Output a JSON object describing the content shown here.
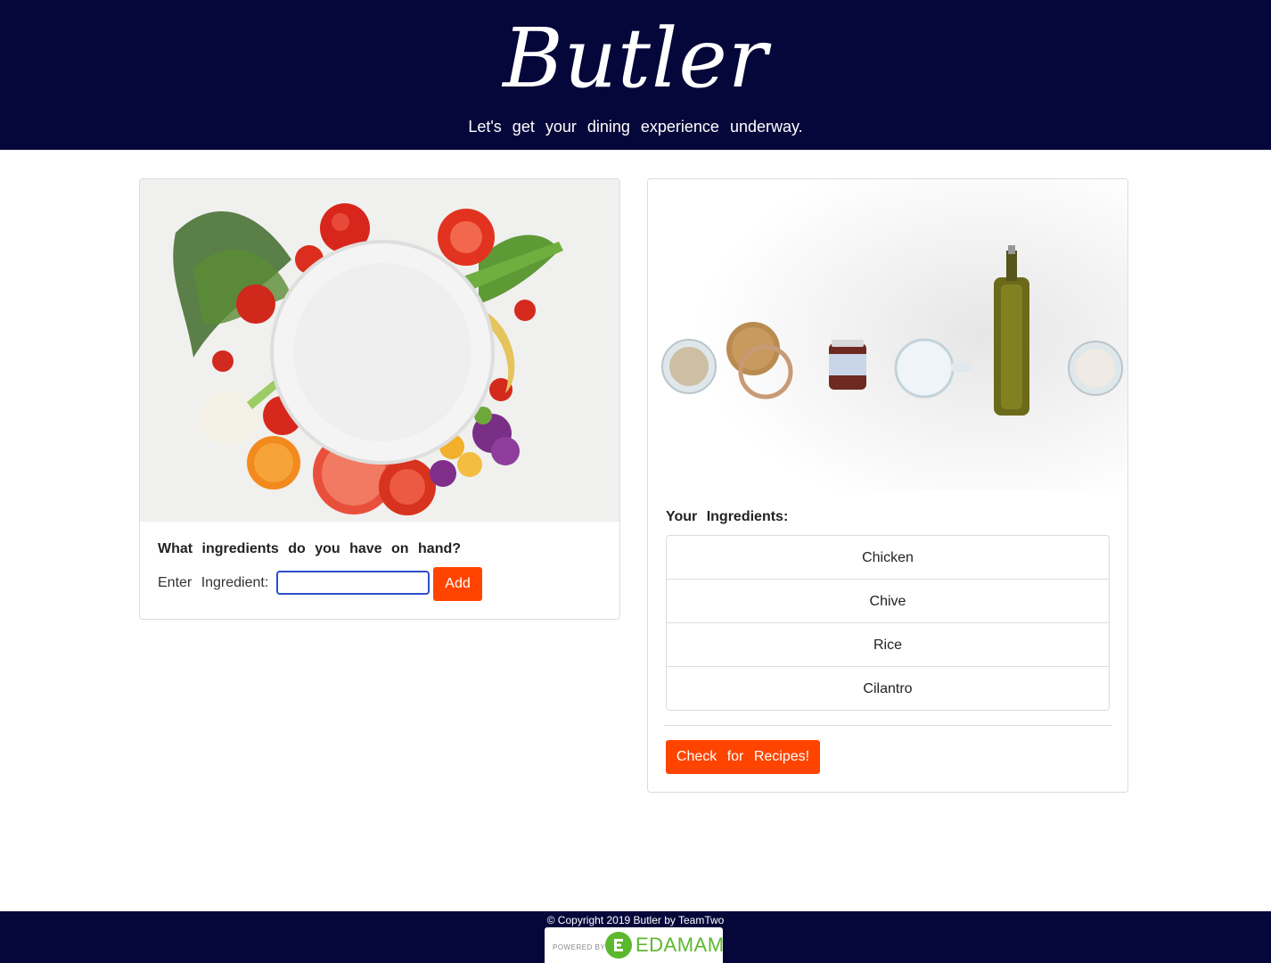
{
  "header": {
    "brand": "Butler",
    "tagline": "Let's get your dining experience underway."
  },
  "add_card": {
    "image_icon": "vegetables-plate-photo",
    "question": "What ingredients do you have on hand?",
    "enter_label": "Enter Ingredient:",
    "input_value": "",
    "add_label": "Add"
  },
  "ingredients_card": {
    "image_icon": "pantry-ingredients-photo",
    "title": "Your Ingredients:",
    "items": [
      "Chicken",
      "Chive",
      "Rice",
      "Cilantro"
    ],
    "check_label": "Check for Recipes!"
  },
  "footer": {
    "copyright": "© Copyright 2019 Butler by TeamTwo",
    "powered_by": "POWERED BY",
    "edamam": "EDAMAM"
  },
  "colors": {
    "navy": "#05073a",
    "accent": "#ff4400",
    "edamam_green": "#5cb82e"
  }
}
